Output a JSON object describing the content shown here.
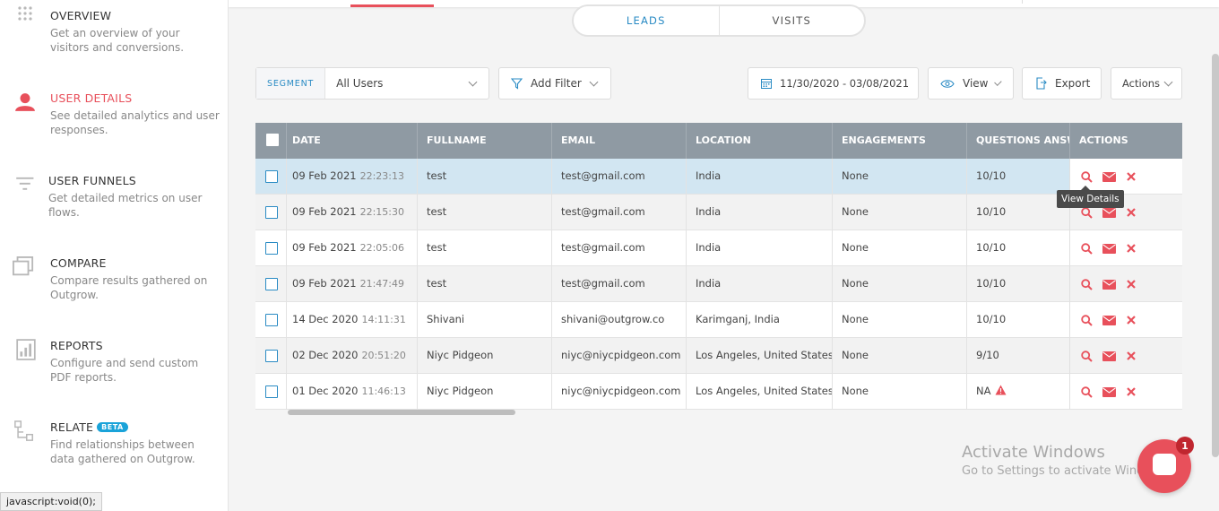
{
  "sidebar": {
    "items": [
      {
        "title": "OVERVIEW",
        "desc": "Get an overview of your visitors and conversions."
      },
      {
        "title": "USER DETAILS",
        "desc": "See detailed analytics and user responses."
      },
      {
        "title": "USER FUNNELS",
        "desc": "Get detailed metrics on user flows."
      },
      {
        "title": "COMPARE",
        "desc": "Compare results gathered on Outgrow."
      },
      {
        "title": "REPORTS",
        "desc": "Configure and send custom PDF reports."
      },
      {
        "title": "RELATE",
        "desc": "Find relationships between data gathered on Outgrow.",
        "badge": "BETA"
      }
    ]
  },
  "status_bar": "javascript:void(0);",
  "tabs": [
    {
      "label": "LEADS"
    },
    {
      "label": "VISITS"
    }
  ],
  "toolbar": {
    "segment_label": "SEGMENT",
    "segment_value": "All Users",
    "filter_label": "Add Filter",
    "date_range": "11/30/2020 - 03/08/2021",
    "view_label": "View",
    "export_label": "Export",
    "actions_label": "Actions"
  },
  "table": {
    "headers": [
      "DATE",
      "FULLNAME",
      "EMAIL",
      "LOCATION",
      "ENGAGEMENTS",
      "QUESTIONS ANSWERED",
      "ACTIONS"
    ],
    "rows": [
      {
        "date": "09 Feb 2021",
        "time": "22:23:13",
        "name": "test",
        "email": "test@gmail.com",
        "location": "India",
        "engagements": "None",
        "questions": "10/10"
      },
      {
        "date": "09 Feb 2021",
        "time": "22:15:30",
        "name": "test",
        "email": "test@gmail.com",
        "location": "India",
        "engagements": "None",
        "questions": "10/10"
      },
      {
        "date": "09 Feb 2021",
        "time": "22:05:06",
        "name": "test",
        "email": "test@gmail.com",
        "location": "India",
        "engagements": "None",
        "questions": "10/10"
      },
      {
        "date": "09 Feb 2021",
        "time": "21:47:49",
        "name": "test",
        "email": "test@gmail.com",
        "location": "India",
        "engagements": "None",
        "questions": "10/10"
      },
      {
        "date": "14 Dec 2020",
        "time": "14:11:31",
        "name": "Shivani",
        "email": "shivani@outgrow.co",
        "location": "Karimganj, India",
        "engagements": "None",
        "questions": "10/10"
      },
      {
        "date": "02 Dec 2020",
        "time": "20:51:20",
        "name": "Niyc Pidgeon",
        "email": "niyc@niycpidgeon.com",
        "location": "Los Angeles, United States",
        "engagements": "None",
        "questions": "9/10"
      },
      {
        "date": "01 Dec 2020",
        "time": "11:46:13",
        "name": "Niyc Pidgeon",
        "email": "niyc@niycpidgeon.com",
        "location": "Los Angeles, United States",
        "engagements": "None",
        "questions": "NA",
        "warning": true
      }
    ]
  },
  "tooltip": "View Details",
  "watermark": {
    "line1": "Activate Windows",
    "line2": "Go to Settings to activate Windows."
  },
  "chat": {
    "badge": "1"
  },
  "colors": {
    "accent": "#e8505b",
    "link": "#2a8bc4",
    "header": "#8f9aa3",
    "highlight": "#d2e6f2"
  }
}
